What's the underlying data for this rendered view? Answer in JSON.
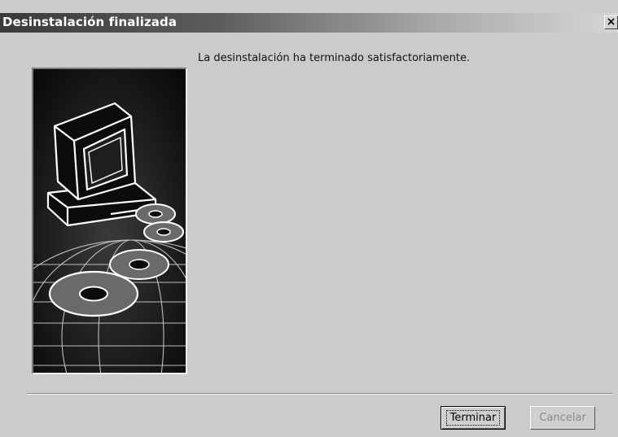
{
  "window": {
    "title": "Desinstalación finalizada",
    "close_glyph": "×"
  },
  "content": {
    "message": "La desinstalación ha terminado satisfactoriamente."
  },
  "buttons": {
    "finish_label": "Terminar",
    "cancel_label": "Cancelar"
  },
  "art": {
    "icon": "computer-with-discs-illustration"
  }
}
